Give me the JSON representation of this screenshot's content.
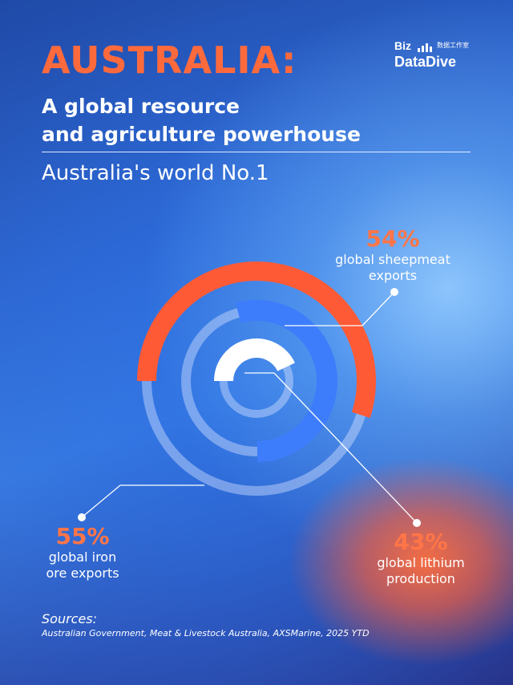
{
  "header": {
    "title": "AUSTRALIA:",
    "subtitle_line1": "A global resource",
    "subtitle_line2": "and agriculture powerhouse",
    "section": "Australia's world No.1"
  },
  "logo": {
    "biz": "Biz",
    "chinese": "数据工作室",
    "datadive": "DataDive"
  },
  "chart_data": {
    "type": "radial_bar",
    "series": [
      {
        "value_label": "55%",
        "value": 55,
        "description": "global iron ore exports",
        "color": "#ff5a36"
      },
      {
        "value_label": "54%",
        "value": 54,
        "description": "global sheepmeat exports",
        "color": "#3d7dfb"
      },
      {
        "value_label": "43%",
        "value": 43,
        "description": "global lithium production",
        "color": "#ffffff"
      }
    ],
    "track_color": "rgba(210,225,255,0.45)"
  },
  "labels": {
    "sheep": {
      "pct": "54%",
      "line1": "global sheepmeat",
      "line2": "exports"
    },
    "iron": {
      "pct": "55%",
      "line1": "global iron",
      "line2": "ore exports"
    },
    "lithium": {
      "pct": "43%",
      "line1": "global lithium",
      "line2": "production"
    }
  },
  "sources": {
    "heading": "Sources:",
    "text": "Australian Government, Meat & Livestock Australia, AXSMarine, 2025 YTD"
  }
}
